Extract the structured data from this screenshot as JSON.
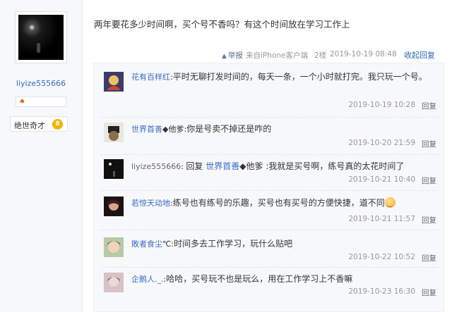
{
  "user": {
    "name": "liyize555666",
    "badge_level_name": "绝世奇才",
    "badge_level_num": "8",
    "small_badge": "♠"
  },
  "post": {
    "content": "两年要花多少时间啊，买个号不香吗？有这个时间放在学习工作上",
    "report_label": "举报",
    "client": "来自iPhone客户端",
    "floor": "2楼",
    "time": "2019-10-19 08:48",
    "collapse_label": "收起回复"
  },
  "comments": [
    {
      "user": "花有百样红",
      "user_suffix": "",
      "text": "平时无聊打发时间的，每天一条，一个小时就打完。我只玩一个号。",
      "time": "2019-10-19 10:28",
      "reply": "回复"
    },
    {
      "user": "世界首善",
      "user_suffix": "◆他爹",
      "text": "你是号卖不掉还是咋的",
      "time": "2019-10-20 21:59",
      "reply": "回复"
    },
    {
      "user": "liyize555666",
      "user_suffix": "",
      "reply_prefix": "回复",
      "reply_to": "世界首善",
      "reply_to_suffix": "◆他爹",
      "text": "我就是买号啊，练号真的太花时间了",
      "time": "2019-10-21 10:40",
      "reply": "回复"
    },
    {
      "user": "若惊天动地",
      "user_suffix": "",
      "text": "练号也有练号的乐趣，买号也有买号的方便快捷，道不同",
      "time": "2019-10-21 11:57",
      "reply": "回复"
    },
    {
      "user": "敗者食尘",
      "user_suffix": "℃",
      "text": "时间多去工作学习，玩什么贴吧",
      "time": "2019-10-22 10:52",
      "reply": "回复"
    },
    {
      "user": "企鹅人._.",
      "user_suffix": "",
      "text": "哈哈，买号玩不也是玩么，用在工作学习上不香嘛",
      "time": "2019-10-23 16:30",
      "reply": "回复"
    }
  ],
  "colors": {
    "link": "#3a6bc7",
    "meta": "#999999",
    "panel": "#f7f8fa"
  }
}
